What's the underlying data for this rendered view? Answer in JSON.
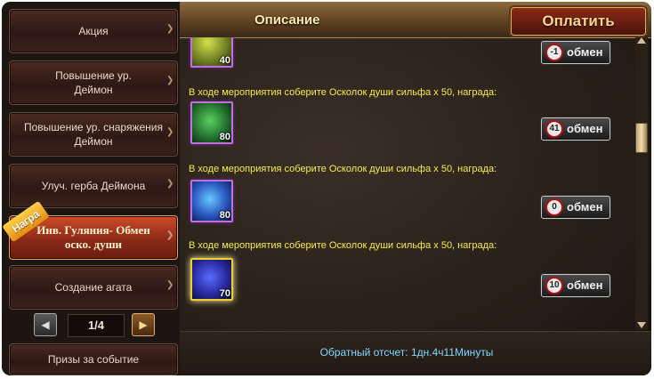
{
  "header": {
    "title": "Описание",
    "pay_label": "Оплатить"
  },
  "sidebar": {
    "items": [
      {
        "label": "Акция"
      },
      {
        "label": "Повышение ур. Деймон"
      },
      {
        "label": "Повышение ур. снаряжения Деймон"
      },
      {
        "label": "Улуч. герба Деймона"
      },
      {
        "label": "Инв. Гуляния- Обмен оско. души",
        "badge": "Награ"
      },
      {
        "label": "Создание агата"
      },
      {
        "label": "Призы за событие"
      }
    ],
    "pager": {
      "text": "1/4",
      "prev": "◀",
      "next": "▶"
    }
  },
  "rows": [
    {
      "text": "",
      "count": "40",
      "exchange_count": "-1",
      "exchange_label": "обмен"
    },
    {
      "text": "В ходе мероприятия соберите Осколок души сильфа х 50, награда:",
      "count": "80",
      "exchange_count": "41",
      "exchange_label": "обмен"
    },
    {
      "text": "В ходе мероприятия соберите Осколок души сильфа х 50, награда:",
      "count": "80",
      "exchange_count": "0",
      "exchange_label": "обмен"
    },
    {
      "text": "В ходе мероприятия соберите Осколок души сильфа х 50, награда:",
      "count": "70",
      "exchange_count": "10",
      "exchange_label": "обмен"
    }
  ],
  "footer": {
    "countdown": "Обратный отсчет: 1дн.4ч11Минуты"
  }
}
